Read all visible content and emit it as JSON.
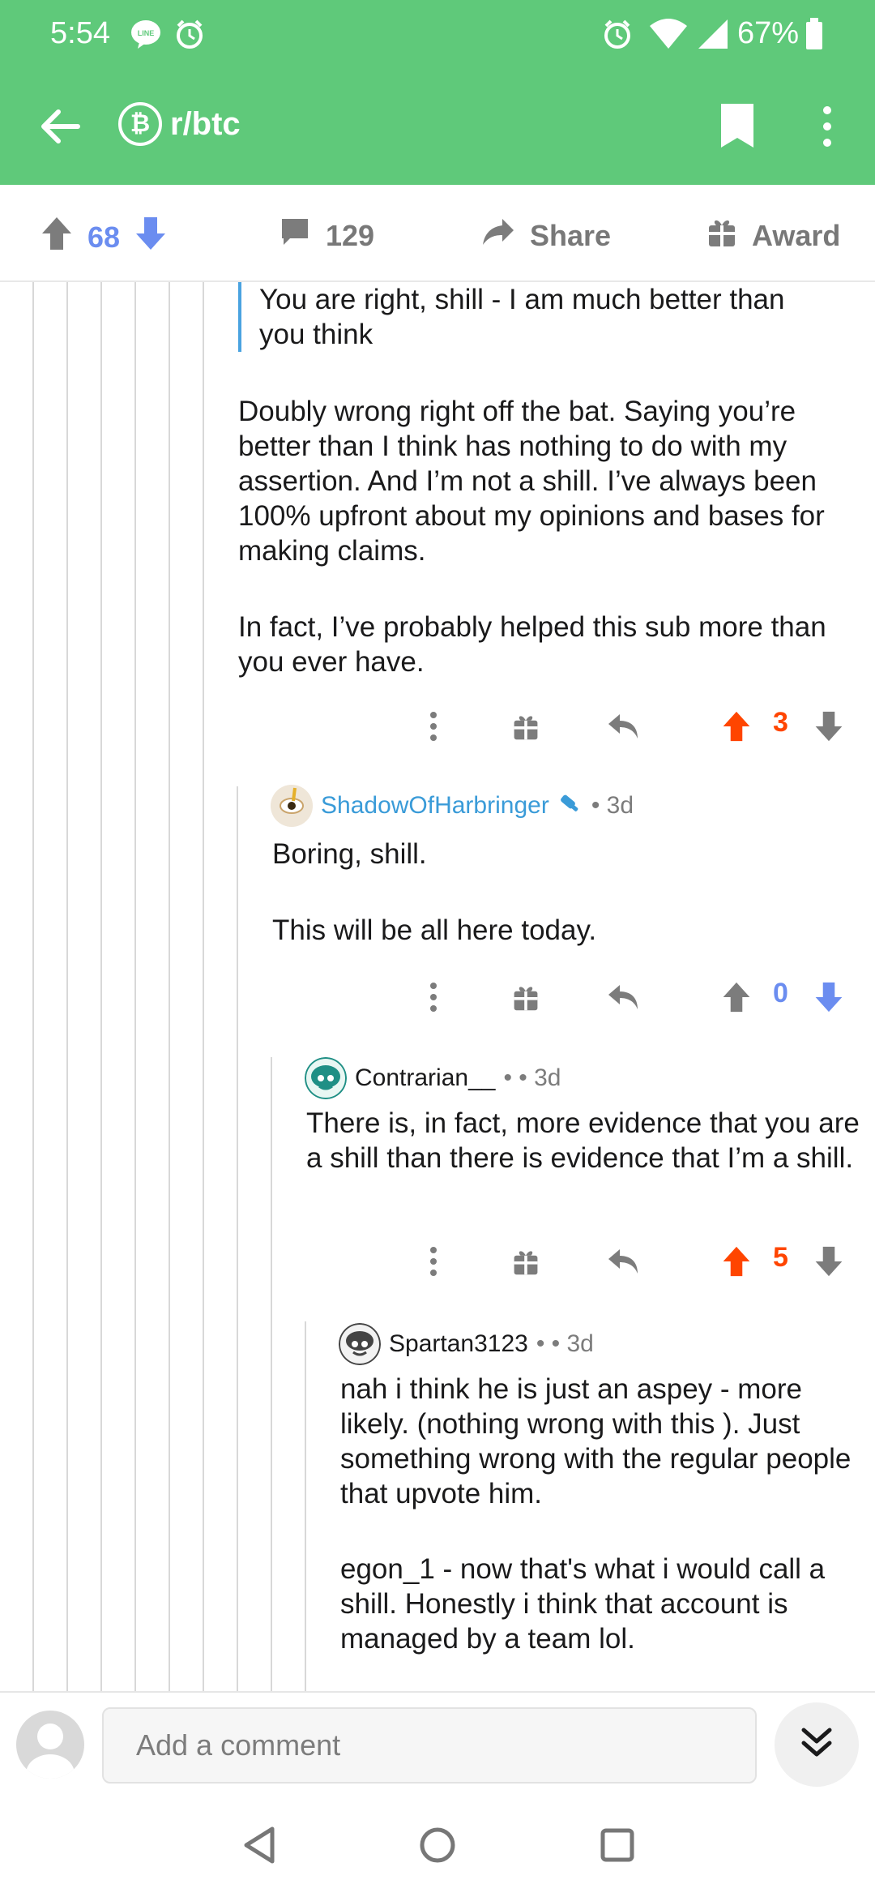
{
  "status_bar": {
    "time": "5:54",
    "battery": "67%",
    "icons": [
      "line-icon",
      "alarm-icon",
      "alarm-icon",
      "wifi-icon",
      "signal-icon",
      "battery-icon"
    ]
  },
  "app_bar": {
    "subreddit": "r/btc",
    "subreddit_icon": "bitcoin-icon",
    "coin_glyph": "₿"
  },
  "post_actions": {
    "votes": "68",
    "comments": "129",
    "share_label": "Share",
    "award_label": "Award"
  },
  "thread": {
    "quote": "You are right, shill - I am much better than you think",
    "reply_paragraphs": [
      "Doubly wrong right off the bat. Saying you’re better than I think has nothing to do with my assertion. And I’m not a shill. I’ve always been 100% upfront about my opinions and bases for making claims.",
      "In fact, I’ve probably helped this sub more than you ever have."
    ],
    "reply_score": "3",
    "comments": [
      {
        "user": "ShadowOfHarbringer",
        "time": "• 3d",
        "paragraphs": [
          "Boring, shill.",
          "This will be all here today."
        ],
        "score": "0"
      },
      {
        "user": "Contrarian__",
        "time": "• • 3d",
        "paragraphs": [
          "There is, in fact, more evidence that you are a shill than there is evidence that I’m a shill."
        ],
        "score": "5"
      },
      {
        "user": "Spartan3123",
        "time": "• • 3d",
        "paragraphs": [
          "nah i think he is just an aspey - more likely. (nothing wrong with this ). Just something wrong with the regular people that upvote him.",
          "egon_1 - now that's what i would call a shill. Honestly i think that account is managed by a team lol."
        ]
      }
    ]
  },
  "bottom": {
    "comment_placeholder": "Add a comment"
  },
  "colors": {
    "brand_green": "#5fc97a",
    "upvote_orange": "#ff4500",
    "downvote_blue": "#6b8df0",
    "link_blue": "#3a9bd8"
  }
}
